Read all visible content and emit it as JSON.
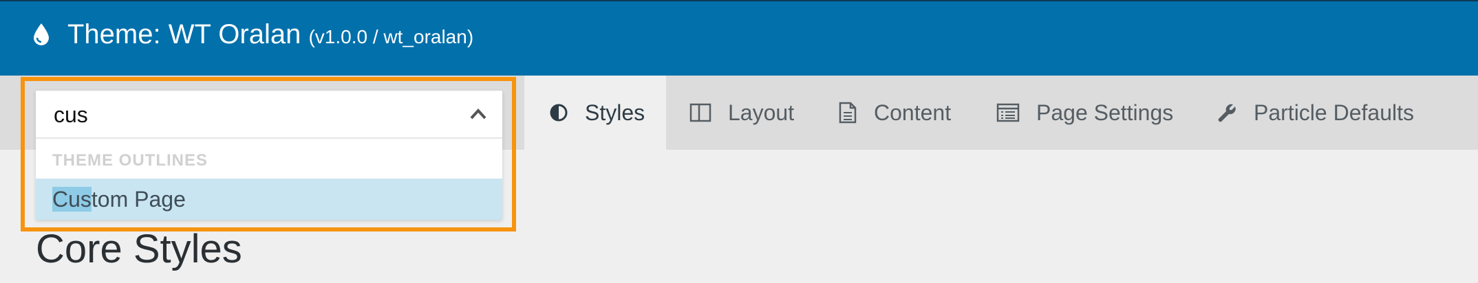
{
  "header": {
    "title": "Theme: WT Oralan",
    "version": "(v1.0.0 / wt_oralan)"
  },
  "outline_select": {
    "value": "cus",
    "group_label": "THEME OUTLINES",
    "option": {
      "match": "Cus",
      "rest": "tom Page"
    }
  },
  "tabs": [
    {
      "label": "Styles",
      "icon": "half-circle-icon",
      "active": true
    },
    {
      "label": "Layout",
      "icon": "columns-icon",
      "active": false
    },
    {
      "label": "Content",
      "icon": "document-icon",
      "active": false
    },
    {
      "label": "Page Settings",
      "icon": "list-window-icon",
      "active": false
    },
    {
      "label": "Particle Defaults",
      "icon": "wrench-icon",
      "active": false
    }
  ],
  "main": {
    "heading": "Core Styles"
  },
  "colors": {
    "header_bg": "#0170ab",
    "highlight_border": "#f7940f",
    "option_highlight": "#c8e5f1"
  }
}
